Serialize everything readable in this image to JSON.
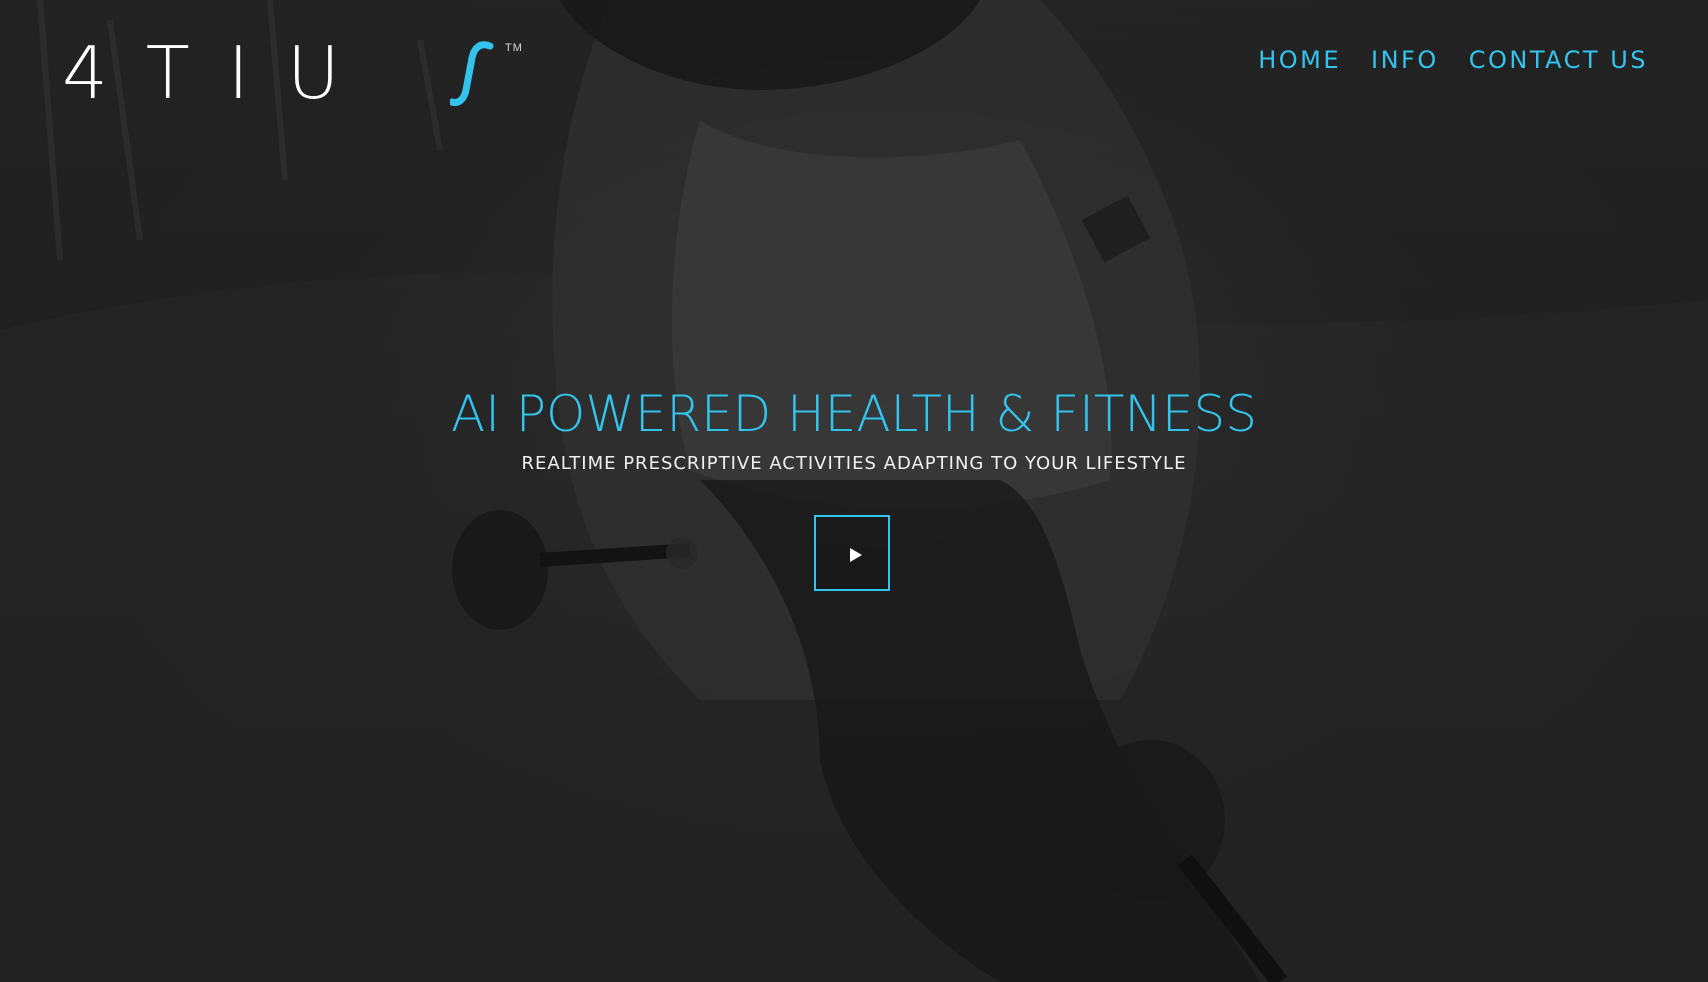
{
  "brand": {
    "logo_text": "4TIU",
    "logo_s": "S",
    "trademark": "TM"
  },
  "nav": {
    "items": [
      {
        "label": "HOME"
      },
      {
        "label": "INFO"
      },
      {
        "label": "CONTACT US"
      }
    ]
  },
  "hero": {
    "title": "AI POWERED HEALTH & FITNESS",
    "subtitle": "REALTIME PRESCRIPTIVE ACTIVITIES ADAPTING TO YOUR LIFESTYLE",
    "play_icon": "play-icon"
  },
  "colors": {
    "accent": "#33c4ee",
    "text_light": "#ffffff",
    "background": "#2a2a2a"
  }
}
